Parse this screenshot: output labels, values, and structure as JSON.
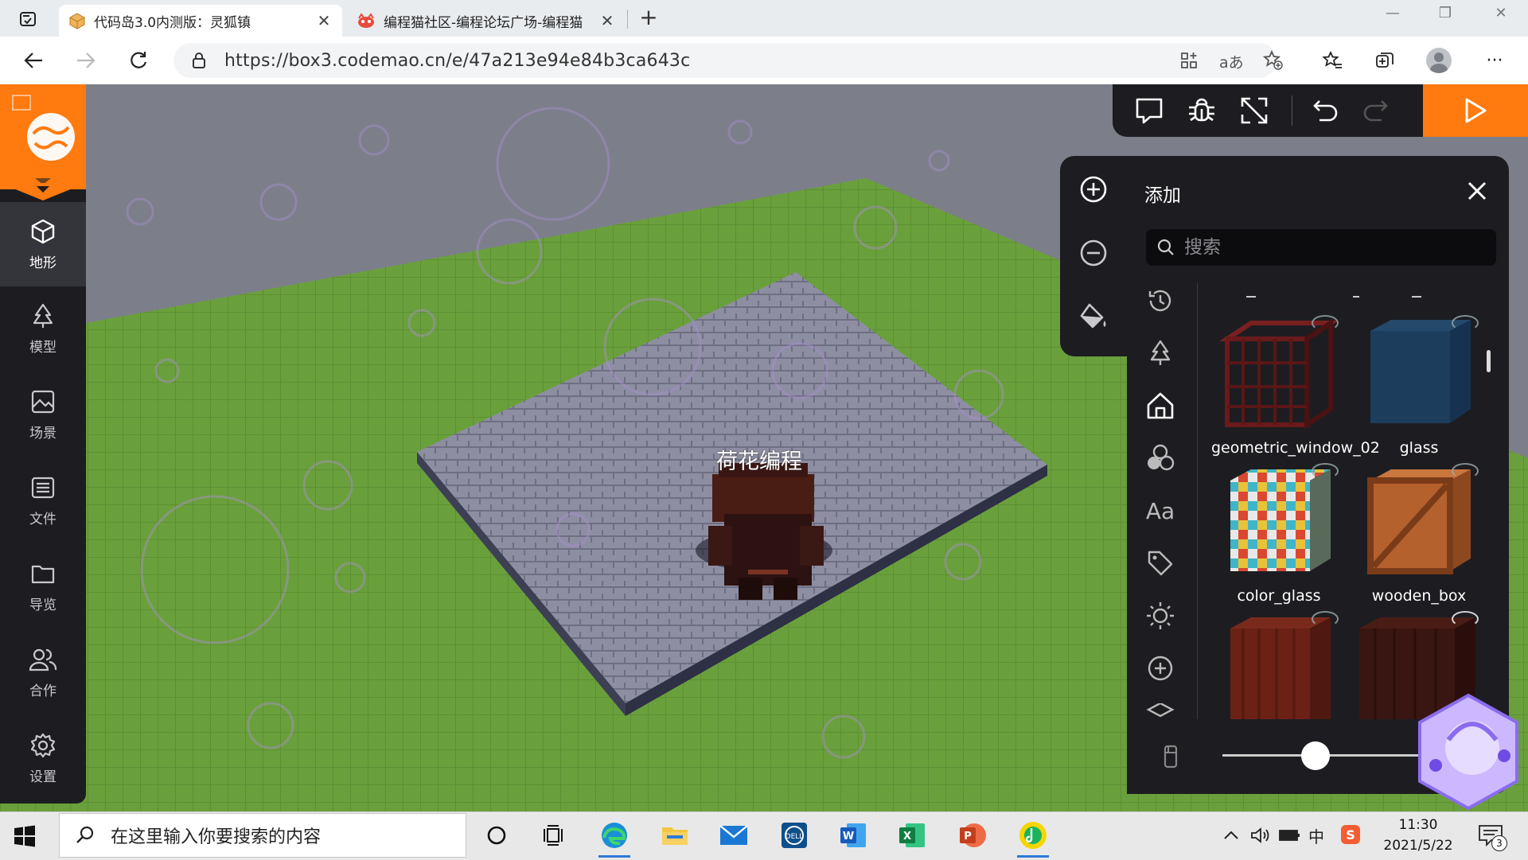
{
  "browser": {
    "tabs": [
      {
        "title": "代码岛3.0内测版：灵狐镇",
        "icon": "box-icon",
        "active": true
      },
      {
        "title": "编程猫社区-编程论坛广场-编程猫",
        "icon": "codemao-icon",
        "active": false
      }
    ],
    "url": "https://box3.codemao.cn/e/47a213e94e84b3ca643c",
    "colors": {
      "accent": "#ff7a0f",
      "panel": "#1d1d21"
    }
  },
  "editor": {
    "nav": [
      {
        "label": "地形",
        "icon": "cube-icon",
        "active": true
      },
      {
        "label": "模型",
        "icon": "tree-icon",
        "active": false
      },
      {
        "label": "场景",
        "icon": "image-icon",
        "active": false
      },
      {
        "label": "文件",
        "icon": "file-icon",
        "active": false
      },
      {
        "label": "导览",
        "icon": "folder-icon",
        "active": false
      },
      {
        "label": "合作",
        "icon": "users-icon",
        "active": false
      },
      {
        "label": "设置",
        "icon": "gear-icon",
        "active": false
      }
    ],
    "scene": {
      "player_name": "荷花编程"
    },
    "add_panel": {
      "title": "添加",
      "search_placeholder": "搜索",
      "items": [
        {
          "name": "geometric_window_02",
          "color": "#5a1616"
        },
        {
          "name": "glass",
          "color": "#1c3d5c"
        },
        {
          "name": "color_glass",
          "color": "#7aa"
        },
        {
          "name": "wooden_box",
          "color": "#b5612e"
        },
        {
          "name": "",
          "color": "#6b2116"
        },
        {
          "name": "",
          "color": "#3a1612"
        }
      ],
      "categories": [
        "history-icon",
        "tree-icon",
        "house-icon",
        "shapes-icon",
        "text-icon",
        "tag-icon",
        "sun-icon",
        "plus-circle-icon",
        "layers-icon"
      ],
      "brush_size": 0.45
    }
  },
  "taskbar": {
    "search_placeholder": "在这里输入你要搜索的内容",
    "time": "11:30",
    "date": "2021/5/22",
    "ime": "中",
    "notification_count": "3"
  }
}
